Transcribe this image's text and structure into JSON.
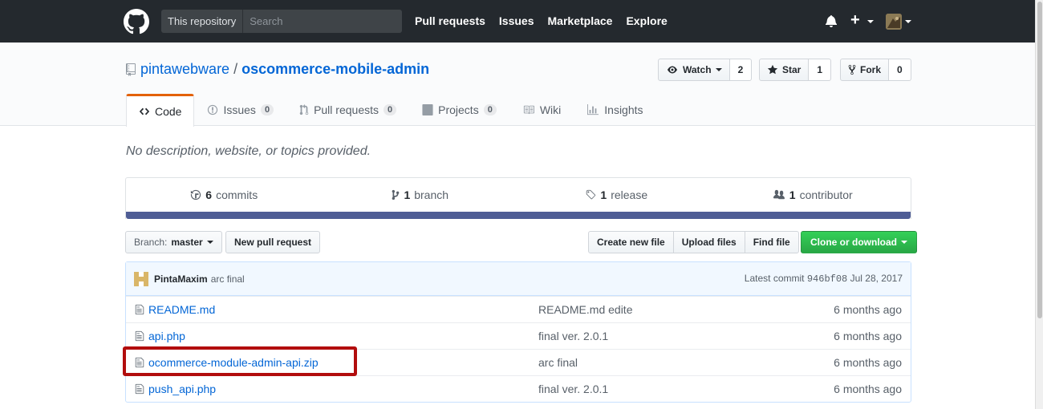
{
  "header": {
    "search_scope": "This repository",
    "search_placeholder": "Search",
    "nav": [
      "Pull requests",
      "Issues",
      "Marketplace",
      "Explore"
    ],
    "plus_label": "+"
  },
  "repo": {
    "owner": "pintawebware",
    "separator": "/",
    "name": "oscommerce-mobile-admin",
    "watch_label": "Watch",
    "watch_count": "2",
    "star_label": "Star",
    "star_count": "1",
    "fork_label": "Fork",
    "fork_count": "0"
  },
  "tabs": [
    {
      "label": "Code",
      "icon": "code-icon"
    },
    {
      "label": "Issues",
      "count": "0",
      "icon": "issue-icon"
    },
    {
      "label": "Pull requests",
      "count": "0",
      "icon": "pull-request-icon"
    },
    {
      "label": "Projects",
      "count": "0",
      "icon": "project-icon"
    },
    {
      "label": "Wiki",
      "icon": "book-icon"
    },
    {
      "label": "Insights",
      "icon": "graph-icon"
    }
  ],
  "description": "No description, website, or topics provided.",
  "summary": [
    {
      "count": "6",
      "label": "commits",
      "icon": "history-icon"
    },
    {
      "count": "1",
      "label": "branch",
      "icon": "branch-icon"
    },
    {
      "count": "1",
      "label": "release",
      "icon": "tag-icon"
    },
    {
      "count": "1",
      "label": "contributor",
      "icon": "people-icon"
    }
  ],
  "lang_bar_color": "#4F5D95",
  "filenav": {
    "branch_prefix": "Branch:",
    "branch": "master",
    "new_pr": "New pull request",
    "create_file": "Create new file",
    "upload": "Upload files",
    "find": "Find file",
    "clone": "Clone or download"
  },
  "commit": {
    "author": "PintaMaxim",
    "message": "arc final",
    "latest_label": "Latest commit",
    "sha": "946bf08",
    "date": "Jul 28, 2017"
  },
  "files": [
    {
      "name": "README.md",
      "message": "README.md edite",
      "age": "6 months ago"
    },
    {
      "name": "api.php",
      "message": "final ver. 2.0.1",
      "age": "6 months ago"
    },
    {
      "name": "ocommerce-module-admin-api.zip",
      "message": "arc final",
      "age": "6 months ago"
    },
    {
      "name": "push_api.php",
      "message": "final ver. 2.0.1",
      "age": "6 months ago"
    }
  ],
  "colors": {
    "header_bg": "#24292e",
    "link": "#0366d6",
    "accent_tab": "#e36209",
    "clone_btn": "#28a745",
    "annotation": "#b20d0d"
  }
}
